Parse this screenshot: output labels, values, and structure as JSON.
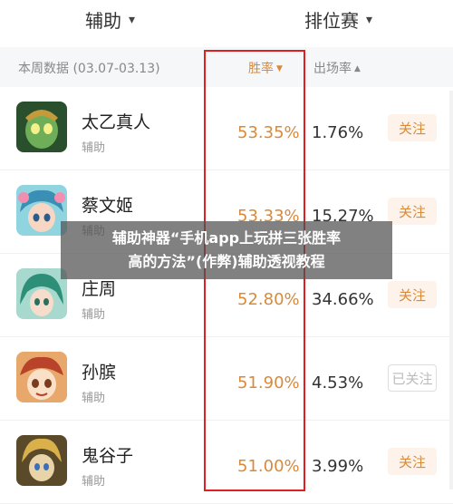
{
  "tabs": [
    {
      "label": "辅助",
      "icon": "chevron-down-icon"
    },
    {
      "label": "排位赛",
      "icon": "chevron-down-icon"
    }
  ],
  "header": {
    "week": "本周数据 (03.07-03.13)",
    "win_rate": "胜率",
    "pick_rate": "出场率"
  },
  "rows": [
    {
      "name": "太乙真人",
      "role": "辅助",
      "win_rate": "53.35%",
      "pick_rate": "1.76%",
      "button": "关注",
      "followed": false,
      "avatar_color": "#3d6b3a"
    },
    {
      "name": "蔡文姬",
      "role": "辅助",
      "win_rate": "53.33%",
      "pick_rate": "15.27%",
      "button": "关注",
      "followed": false,
      "avatar_color": "#4fb6c8"
    },
    {
      "name": "庄周",
      "role": "辅助",
      "win_rate": "52.80%",
      "pick_rate": "34.66%",
      "button": "关注",
      "followed": false,
      "avatar_color": "#3e9a86"
    },
    {
      "name": "孙膑",
      "role": "辅助",
      "win_rate": "51.90%",
      "pick_rate": "4.53%",
      "button": "已关注",
      "followed": true,
      "avatar_color": "#c85a3c"
    },
    {
      "name": "鬼谷子",
      "role": "辅助",
      "win_rate": "51.00%",
      "pick_rate": "3.99%",
      "button": "关注",
      "followed": false,
      "avatar_color": "#b98a2a"
    }
  ],
  "overlay": {
    "line1": "辅助神器“手机app上玩拼三张胜率",
    "line2": "高的方法”(作弊)辅助透视教程"
  },
  "colors": {
    "accent": "#d88a3c",
    "highlight": "#e02020"
  }
}
